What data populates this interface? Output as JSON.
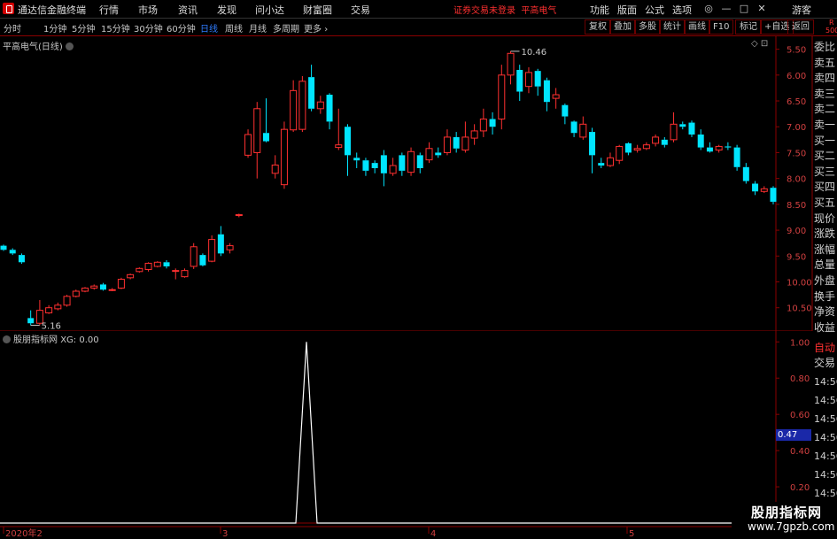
{
  "app": {
    "name": "通达信金融终端",
    "menus": [
      "行情",
      "市场",
      "资讯",
      "发现",
      "问小达",
      "财富圈",
      "交易"
    ],
    "status": "证券交易未登录",
    "stock_name_top": "平高电气",
    "right_menus": [
      "功能",
      "版面",
      "公式",
      "选项"
    ],
    "guest": "游客"
  },
  "periods": {
    "items": [
      "分时",
      "1分钟",
      "5分钟",
      "15分钟",
      "30分钟",
      "60分钟",
      "日线",
      "周线",
      "月线",
      "多周期",
      "更多"
    ],
    "active": "日线",
    "tools": [
      "复权",
      "叠加",
      "多股",
      "统计",
      "画线",
      "F10",
      "标记",
      "+自选",
      "返回"
    ]
  },
  "right_panel": {
    "top_tag": "R",
    "top_num": "500",
    "labels": [
      "委比",
      "卖五",
      "卖四",
      "卖三",
      "卖二",
      "卖一",
      "买一",
      "买二",
      "买三",
      "买四",
      "买五",
      "现价",
      "涨跌",
      "涨幅",
      "总量",
      "外盘",
      "换手",
      "净资",
      "收益"
    ],
    "auto_trade": "自动",
    "trade": "交易",
    "times": [
      "14:56",
      "14:56",
      "14:56",
      "14:56",
      "14:56",
      "14:56",
      "14:56",
      "14:56"
    ]
  },
  "main": {
    "title": "平高电气(日线)",
    "y_ticks": [
      "10.50",
      "10.00",
      "9.50",
      "9.00",
      "8.50",
      "8.00",
      "7.50",
      "7.00",
      "6.50",
      "6.00",
      "5.50"
    ],
    "low_label": "5.16",
    "high_label": "10.46"
  },
  "sub": {
    "title": "股朋指标网",
    "value_text": "XG: 0.00",
    "y_ticks": [
      "1.00",
      "0.80",
      "0.60",
      "0.40",
      "0.20"
    ],
    "cursor_value": "0.47",
    "date_labels": [
      "2020年2",
      "3",
      "4",
      "5"
    ]
  },
  "watermark": {
    "title": "股朋指标网",
    "url": "www.7gpzb.com"
  },
  "chart_data": {
    "type": "candlestick",
    "title": "平高电气(日线)",
    "ylim": [
      5.05,
      10.75
    ],
    "y_ticks": [
      5.5,
      6.0,
      6.5,
      7.0,
      7.5,
      8.0,
      8.5,
      9.0,
      9.5,
      10.0,
      10.5
    ],
    "low_annotation": 5.16,
    "high_annotation": 10.46,
    "x_labels": [
      "2020年2",
      "3",
      "4",
      "5"
    ],
    "candles": [
      [
        6.7,
        6.62,
        6.72,
        6.6
      ],
      [
        6.62,
        6.55,
        6.65,
        6.52
      ],
      [
        6.52,
        6.38,
        6.55,
        6.35
      ],
      [
        5.3,
        5.2,
        5.45,
        5.16
      ],
      [
        5.2,
        5.45,
        5.65,
        5.16
      ],
      [
        5.4,
        5.5,
        5.55,
        5.38
      ],
      [
        5.48,
        5.55,
        5.6,
        5.45
      ],
      [
        5.55,
        5.72,
        5.75,
        5.52
      ],
      [
        5.72,
        5.82,
        5.85,
        5.7
      ],
      [
        5.82,
        5.88,
        5.9,
        5.8
      ],
      [
        5.88,
        5.92,
        5.95,
        5.85
      ],
      [
        5.95,
        5.85,
        5.98,
        5.83
      ],
      [
        5.85,
        5.85,
        5.88,
        5.82
      ],
      [
        5.88,
        6.05,
        6.08,
        5.86
      ],
      [
        6.08,
        6.14,
        6.16,
        6.05
      ],
      [
        6.2,
        6.26,
        6.28,
        6.18
      ],
      [
        6.24,
        6.36,
        6.38,
        6.2
      ],
      [
        6.3,
        6.38,
        6.4,
        6.28
      ],
      [
        6.38,
        6.3,
        6.42,
        6.26
      ],
      [
        6.22,
        6.22,
        6.26,
        6.05
      ],
      [
        6.1,
        6.22,
        6.26,
        6.08
      ],
      [
        6.3,
        6.68,
        6.75,
        6.25
      ],
      [
        6.52,
        6.32,
        6.55,
        6.3
      ],
      [
        6.4,
        6.82,
        6.9,
        6.38
      ],
      [
        6.92,
        6.55,
        7.08,
        6.5
      ],
      [
        6.62,
        6.7,
        6.75,
        6.55
      ],
      [
        7.3,
        7.3,
        7.32,
        7.25
      ],
      [
        8.45,
        8.85,
        8.95,
        8.4
      ],
      [
        8.5,
        9.35,
        9.48,
        8.0
      ],
      [
        8.88,
        8.72,
        9.55,
        8.7
      ],
      [
        8.1,
        8.26,
        8.45,
        8.0
      ],
      [
        7.88,
        8.95,
        9.1,
        7.8
      ],
      [
        8.94,
        9.7,
        9.9,
        8.9
      ],
      [
        8.95,
        9.88,
        9.98,
        8.9
      ],
      [
        9.96,
        9.35,
        10.2,
        9.3
      ],
      [
        9.35,
        9.48,
        9.6,
        9.25
      ],
      [
        9.62,
        9.1,
        9.65,
        8.95
      ],
      [
        8.6,
        8.65,
        9.35,
        8.55
      ],
      [
        9.0,
        8.45,
        9.05,
        8.05
      ],
      [
        8.4,
        8.35,
        8.5,
        8.2
      ],
      [
        8.35,
        8.15,
        8.4,
        8.05
      ],
      [
        8.3,
        8.2,
        8.35,
        8.1
      ],
      [
        8.45,
        8.1,
        8.55,
        7.85
      ],
      [
        8.1,
        8.25,
        8.4,
        8.05
      ],
      [
        8.45,
        8.15,
        8.5,
        8.05
      ],
      [
        8.12,
        8.52,
        8.6,
        8.05
      ],
      [
        8.45,
        8.2,
        8.5,
        8.1
      ],
      [
        8.36,
        8.58,
        8.7,
        8.3
      ],
      [
        8.5,
        8.45,
        8.6,
        8.4
      ],
      [
        8.5,
        8.8,
        8.95,
        8.45
      ],
      [
        8.8,
        8.58,
        8.9,
        8.5
      ],
      [
        8.55,
        8.8,
        9.1,
        8.5
      ],
      [
        8.78,
        8.92,
        9.05,
        8.65
      ],
      [
        8.92,
        9.15,
        9.35,
        8.8
      ],
      [
        9.15,
        9.0,
        9.28,
        8.85
      ],
      [
        9.15,
        10.0,
        10.2,
        8.95
      ],
      [
        10.0,
        10.42,
        10.46,
        9.82
      ],
      [
        10.1,
        9.68,
        10.2,
        9.5
      ],
      [
        9.78,
        10.05,
        10.15,
        9.65
      ],
      [
        10.08,
        9.78,
        10.12,
        9.6
      ],
      [
        9.9,
        9.48,
        9.95,
        9.3
      ],
      [
        9.55,
        9.62,
        9.75,
        9.35
      ],
      [
        9.42,
        9.2,
        9.45,
        9.05
      ],
      [
        9.1,
        8.88,
        9.12,
        8.8
      ],
      [
        8.8,
        9.05,
        9.2,
        8.75
      ],
      [
        8.9,
        8.45,
        8.98,
        8.1
      ],
      [
        8.3,
        8.25,
        8.4,
        8.2
      ],
      [
        8.25,
        8.4,
        8.5,
        8.22
      ],
      [
        8.35,
        8.62,
        8.65,
        8.28
      ],
      [
        8.68,
        8.5,
        8.7,
        8.45
      ],
      [
        8.55,
        8.58,
        8.65,
        8.5
      ],
      [
        8.58,
        8.65,
        8.7,
        8.55
      ],
      [
        8.68,
        8.8,
        8.85,
        8.62
      ],
      [
        8.75,
        8.65,
        8.8,
        8.6
      ],
      [
        8.75,
        9.05,
        9.28,
        8.7
      ],
      [
        9.05,
        9.0,
        9.1,
        8.95
      ],
      [
        9.08,
        8.85,
        9.12,
        8.8
      ],
      [
        8.85,
        8.6,
        8.95,
        8.55
      ],
      [
        8.6,
        8.52,
        8.7,
        8.5
      ],
      [
        8.55,
        8.62,
        8.65,
        8.5
      ],
      [
        8.62,
        8.6,
        8.7,
        8.55
      ],
      [
        8.6,
        8.22,
        8.65,
        8.15
      ],
      [
        8.22,
        7.95,
        8.3,
        7.9
      ],
      [
        7.9,
        7.75,
        7.95,
        7.68
      ],
      [
        7.75,
        7.8,
        7.85,
        7.72
      ],
      [
        7.82,
        7.55,
        7.85,
        7.5
      ]
    ],
    "sub_indicator": {
      "name": "XG",
      "ylim": [
        0,
        1.06
      ],
      "y_ticks": [
        0.2,
        0.4,
        0.6,
        0.8,
        1.0
      ],
      "spike_value": 1.0,
      "current": 0.0
    }
  }
}
